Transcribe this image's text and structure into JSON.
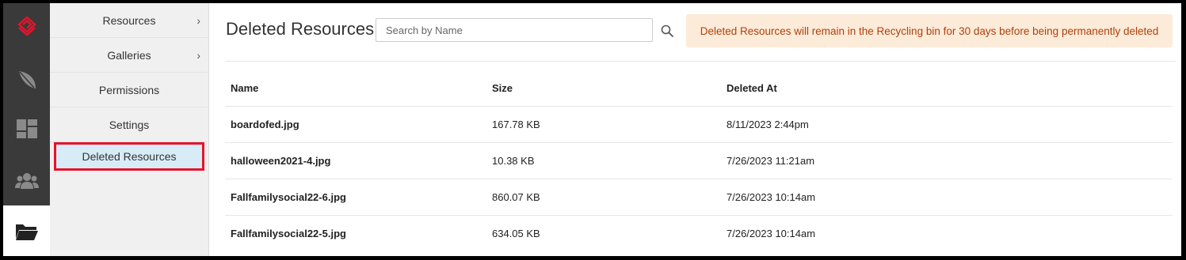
{
  "rail": {
    "items": [
      {
        "icon": "logo-icon"
      },
      {
        "icon": "feather-icon"
      },
      {
        "icon": "dashboard-icon"
      },
      {
        "icon": "users-icon"
      },
      {
        "icon": "folder-open-icon"
      }
    ],
    "accent_color": "#e8132b"
  },
  "subnav": {
    "items": [
      {
        "label": "Resources",
        "has_chevron": true
      },
      {
        "label": "Galleries",
        "has_chevron": true
      },
      {
        "label": "Permissions",
        "has_chevron": false
      },
      {
        "label": "Settings",
        "has_chevron": false
      },
      {
        "label": "Deleted Resources",
        "has_chevron": false,
        "active": true
      }
    ],
    "chevron": "›"
  },
  "main": {
    "title": "Deleted Resources",
    "search": {
      "placeholder": "Search by Name",
      "value": ""
    },
    "notice": "Deleted Resources will remain in the Recycling bin for 30 days before being permanently deleted",
    "table": {
      "headers": [
        "Name",
        "Size",
        "Deleted At"
      ],
      "rows": [
        {
          "name": "boardofed.jpg",
          "size": "167.78 KB",
          "deleted_at": "8/11/2023 2:44pm"
        },
        {
          "name": "halloween2021-4.jpg",
          "size": "10.38 KB",
          "deleted_at": "7/26/2023 11:21am"
        },
        {
          "name": "Fallfamilysocial22-6.jpg",
          "size": "860.07 KB",
          "deleted_at": "7/26/2023 10:14am"
        },
        {
          "name": "Fallfamilysocial22-5.jpg",
          "size": "634.05 KB",
          "deleted_at": "7/26/2023 10:14am"
        }
      ]
    }
  }
}
